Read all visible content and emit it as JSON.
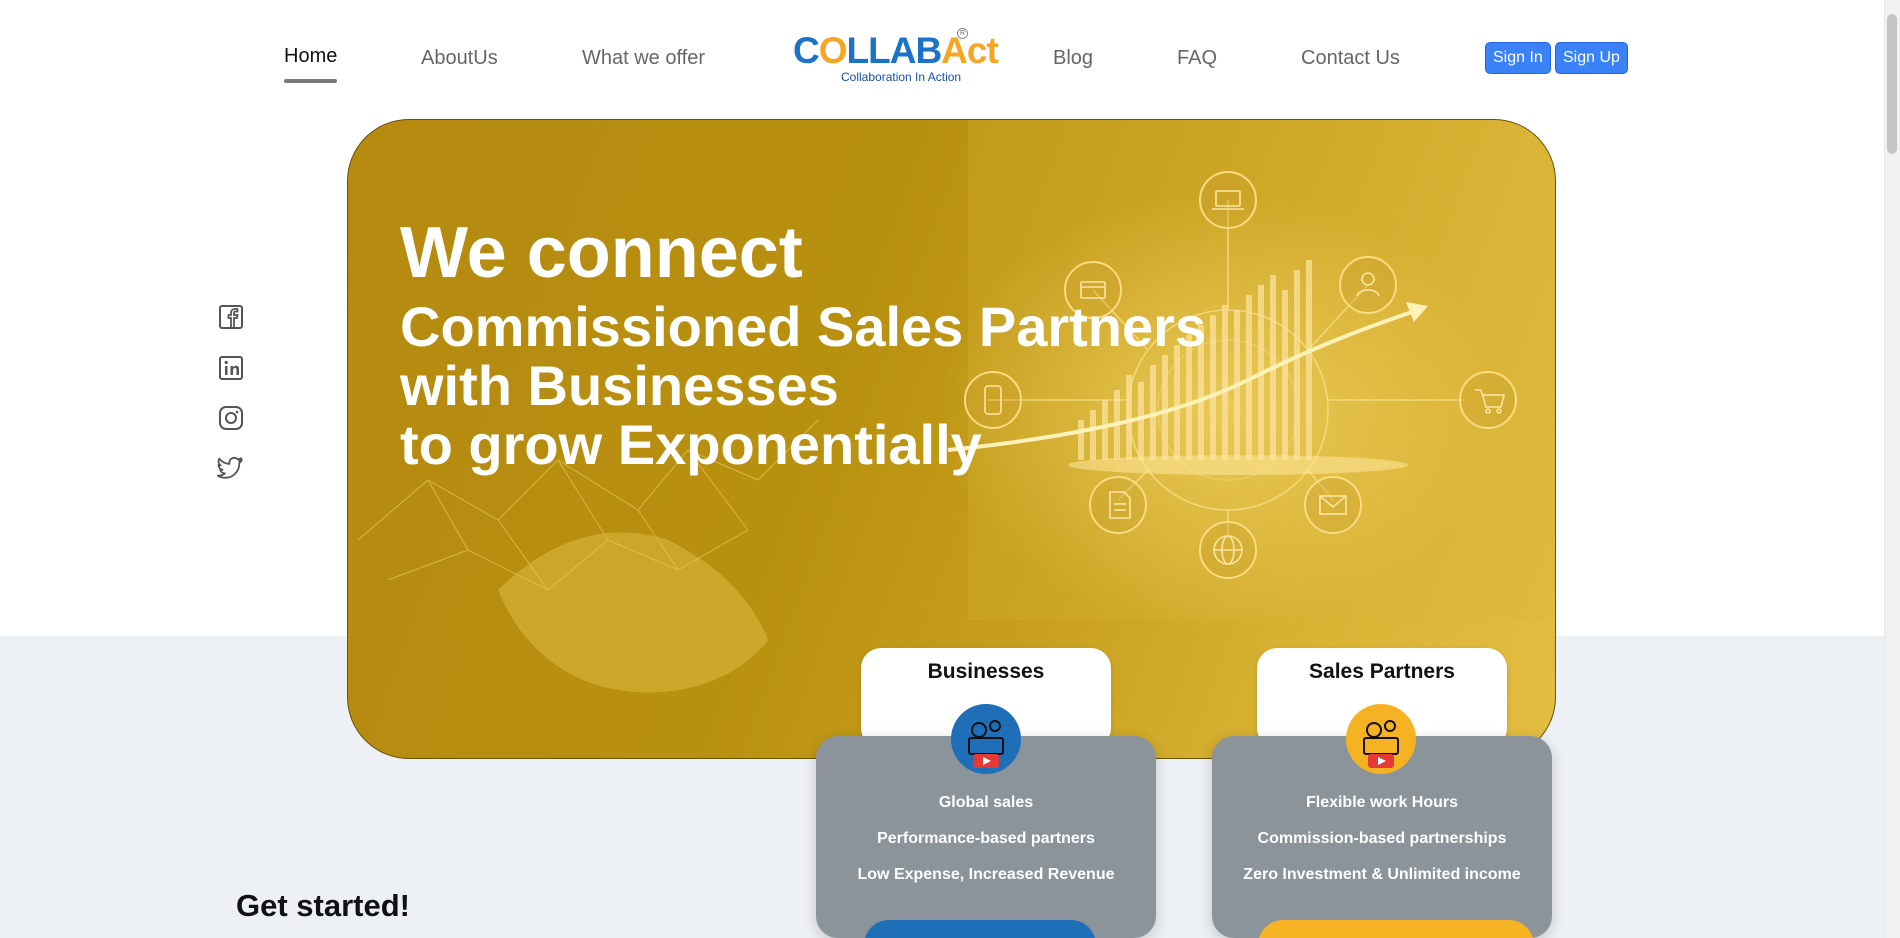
{
  "nav": {
    "home": "Home",
    "about": "AboutUs",
    "offer": "What we offer",
    "blog": "Blog",
    "faq": "FAQ",
    "contact": "Contact Us",
    "sign_in": "Sign In",
    "sign_up": "Sign Up"
  },
  "logo": {
    "text_c": "C",
    "text_o": "O",
    "text_rest": "LLAB",
    "text_act": "Act",
    "tagline": "Collaboration In Action",
    "reg": "R"
  },
  "social": [
    "facebook-icon",
    "linkedin-icon",
    "instagram-icon",
    "twitter-icon"
  ],
  "hero": {
    "line1": "We connect",
    "line2": "Commissioned Sales Partners",
    "line3": "with Businesses",
    "line4": "to grow Exponentially"
  },
  "cards": {
    "businesses": {
      "title": "Businesses",
      "items": [
        "Global sales",
        "Performance-based partners",
        "Low Expense, Increased Revenue"
      ],
      "icon_color": "#1f6fb8"
    },
    "partners": {
      "title": "Sales Partners",
      "items": [
        "Flexible work Hours",
        "Commission-based partnerships",
        "Zero Investment & Unlimited income"
      ],
      "icon_color": "#f5b324"
    }
  },
  "get_started": "Get started!",
  "colors": {
    "accent_blue": "#3b82f6",
    "hero_gold": "#b8900f",
    "card_grey": "#8b939b"
  }
}
